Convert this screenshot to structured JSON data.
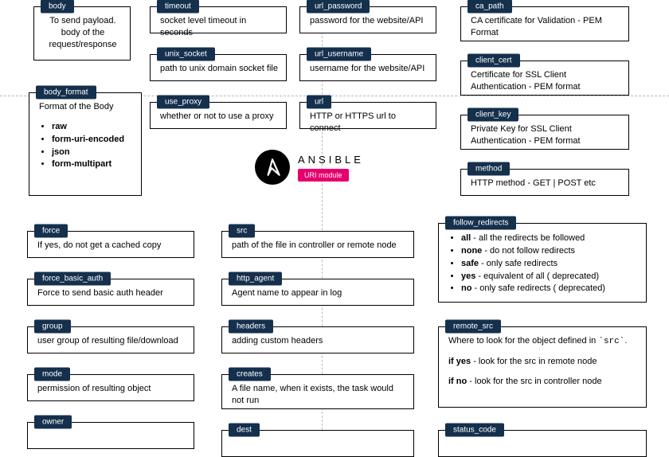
{
  "logo": {
    "name": "ANSIBLE",
    "badge": "URI module"
  },
  "cards": {
    "body": {
      "title": "body",
      "text": "To send payload. body of the request/response"
    },
    "body_format": {
      "title": "body_format",
      "text": "Format of the Body",
      "items": [
        "raw",
        "form-uri-encoded",
        "json",
        "form-multipart"
      ]
    },
    "timeout": {
      "title": "timeout",
      "text": "socket level timeout in seconds"
    },
    "unix_socket": {
      "title": "unix_socket",
      "text": "path to unix domain socket file"
    },
    "use_proxy": {
      "title": "use_proxy",
      "text": "whether or not to use a proxy"
    },
    "url_password": {
      "title": "url_password",
      "text": "password for the website/API"
    },
    "url_username": {
      "title": "url_username",
      "text": "username for the website/API"
    },
    "url": {
      "title": "url",
      "text": "HTTP or HTTPS url to connect"
    },
    "ca_path": {
      "title": "ca_path",
      "text": "CA certificate for Validation - PEM Format"
    },
    "client_cert": {
      "title": "client_cert",
      "text": "Certificate for SSL Client Authentication - PEM format"
    },
    "client_key": {
      "title": "client_key",
      "text": "Private Key for SSL Client Authentication - PEM format"
    },
    "method": {
      "title": "method",
      "text": "HTTP method - GET | POST etc"
    },
    "force": {
      "title": "force",
      "text": "If yes, do not get a cached copy"
    },
    "force_basic_auth": {
      "title": "force_basic_auth",
      "text": "Force to send basic auth header"
    },
    "group": {
      "title": "group",
      "text": "user group of resulting file/download"
    },
    "mode": {
      "title": "mode",
      "text": "permission of resulting object"
    },
    "owner": {
      "title": "owner",
      "text": ""
    },
    "src": {
      "title": "src",
      "text": "path of the file in controller or remote node"
    },
    "http_agent": {
      "title": "http_agent",
      "text": "Agent name to appear in log"
    },
    "headers": {
      "title": "headers",
      "text": "adding custom headers"
    },
    "creates": {
      "title": "creates",
      "text": "A file name, when it exists, the task would not run"
    },
    "dest": {
      "title": "dest",
      "text": ""
    },
    "follow_redirects": {
      "title": "follow_redirects",
      "items_html": [
        "<b>all</b> - all the redirects be followed",
        "<b>none</b> - do not follow redirects",
        "<b>safe</b> - only safe redirects",
        "<b>yes</b> - equivalent of all ( deprecated)",
        "<b>no</b> - only safe redirects ( deprecated)"
      ]
    },
    "remote_src": {
      "title": "remote_src",
      "paras": [
        "Where to look for the object defined in <code>`src`</code>.",
        "<b>if yes</b> - look for the src in remote node",
        "<b>if no</b> - look for the src in controller node"
      ]
    },
    "status_code": {
      "title": "status_code",
      "text": ""
    }
  }
}
